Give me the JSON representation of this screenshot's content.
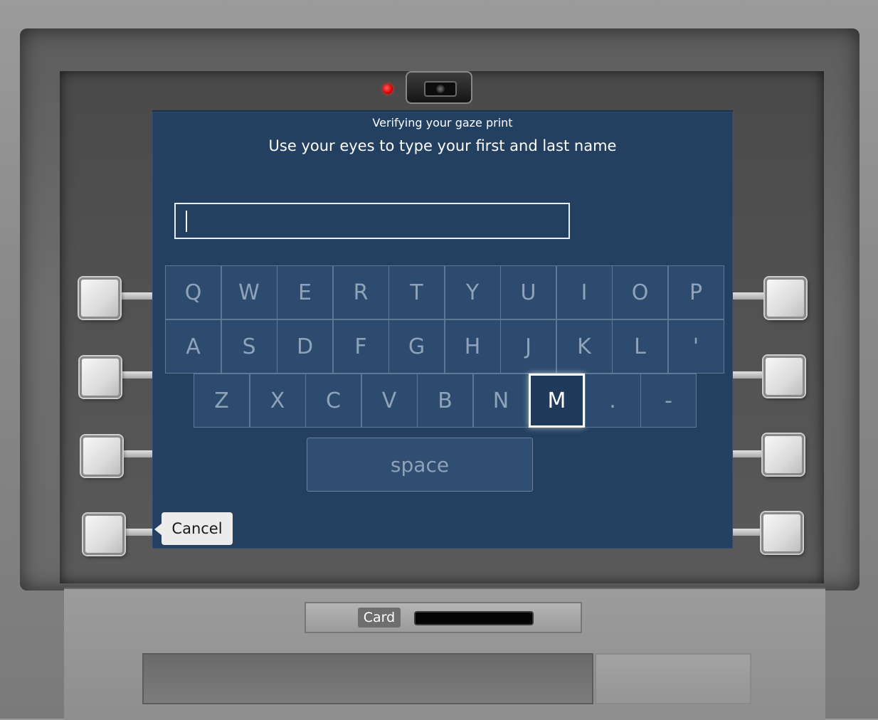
{
  "screen": {
    "subtitle": "Verifying your gaze print",
    "title": "Use your eyes to type your first and last name",
    "name_input": {
      "value": "",
      "placeholder": ""
    }
  },
  "keyboard": {
    "row1": [
      "Q",
      "W",
      "E",
      "R",
      "T",
      "Y",
      "U",
      "I",
      "O",
      "P"
    ],
    "row2": [
      "A",
      "S",
      "D",
      "F",
      "G",
      "H",
      "J",
      "K",
      "L",
      "'"
    ],
    "row3": [
      "Z",
      "X",
      "C",
      "V",
      "B",
      "N",
      "M",
      ".",
      "-"
    ],
    "active_key": "M",
    "space_label": "space"
  },
  "cancel_label": "Cancel",
  "card_label": "Card",
  "colors": {
    "screen_bg": "#244061",
    "key_border": "#5e7794",
    "key_text": "#8ea3ba",
    "active_key_border": "#ffffff",
    "camera_led": "#e00000"
  },
  "icons": {
    "camera": "camera-icon",
    "led": "recording-led-icon"
  }
}
